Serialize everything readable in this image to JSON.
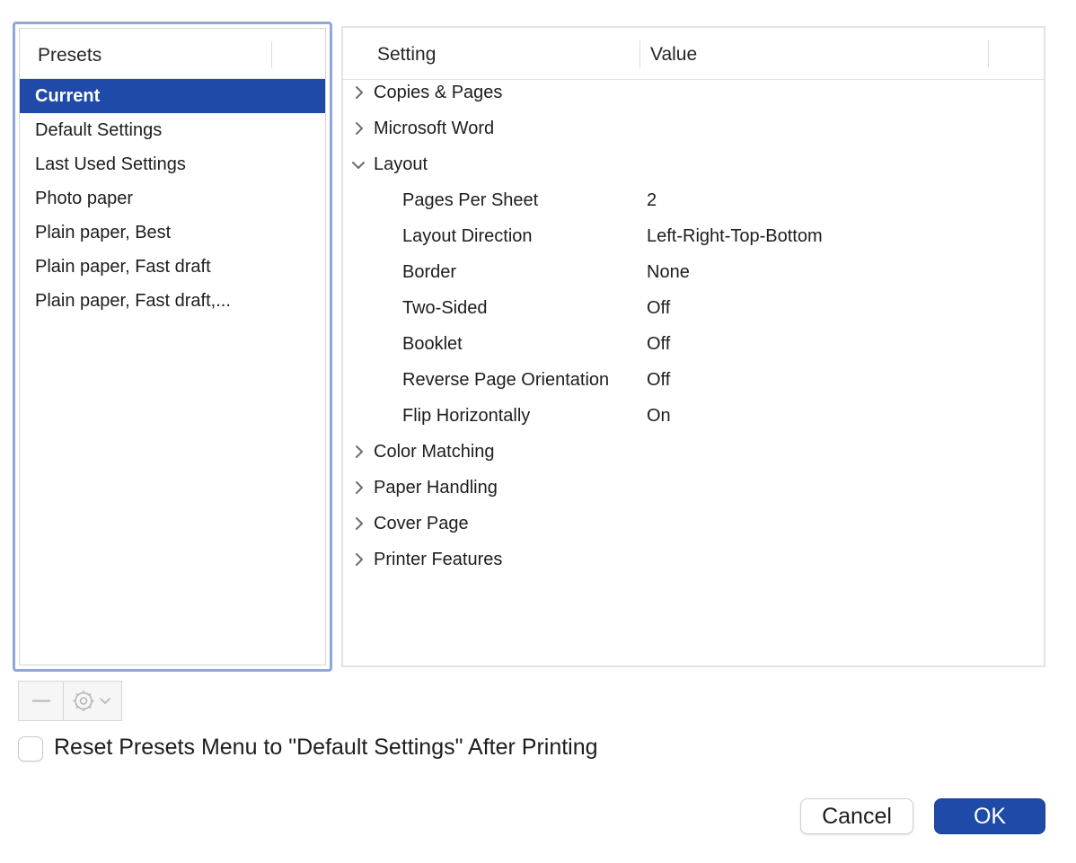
{
  "presets": {
    "header": "Presets",
    "items": [
      {
        "label": "Current",
        "selected": true
      },
      {
        "label": "Default Settings",
        "selected": false
      },
      {
        "label": "Last Used Settings",
        "selected": false
      },
      {
        "label": "Photo paper",
        "selected": false
      },
      {
        "label": "Plain paper, Best",
        "selected": false
      },
      {
        "label": "Plain paper, Fast draft",
        "selected": false
      },
      {
        "label": "Plain paper, Fast draft,...",
        "selected": false
      }
    ]
  },
  "settings": {
    "header_setting": "Setting",
    "header_value": "Value",
    "rows": [
      {
        "label": "Copies & Pages",
        "expanded": false
      },
      {
        "label": "Microsoft Word",
        "expanded": false
      },
      {
        "label": "Layout",
        "expanded": true
      },
      {
        "label": "Pages Per Sheet",
        "value": "2"
      },
      {
        "label": "Layout Direction",
        "value": "Left-Right-Top-Bottom"
      },
      {
        "label": "Border",
        "value": "None"
      },
      {
        "label": "Two-Sided",
        "value": "Off"
      },
      {
        "label": "Booklet",
        "value": "Off"
      },
      {
        "label": "Reverse Page Orientation",
        "value": "Off"
      },
      {
        "label": "Flip Horizontally",
        "value": "On"
      },
      {
        "label": "Color Matching",
        "expanded": false
      },
      {
        "label": "Paper Handling",
        "expanded": false
      },
      {
        "label": "Cover Page",
        "expanded": false
      },
      {
        "label": "Printer Features",
        "expanded": false
      }
    ]
  },
  "toolbar": {
    "remove_icon": "minus-icon",
    "action_icon": "gear-icon"
  },
  "reset_option": {
    "label": "Reset Presets Menu to \"Default Settings\" After Printing",
    "checked": false
  },
  "buttons": {
    "cancel": "Cancel",
    "ok": "OK"
  },
  "colors": {
    "accent": "#1f4aa8",
    "focus_ring": "#8fa8dc"
  }
}
